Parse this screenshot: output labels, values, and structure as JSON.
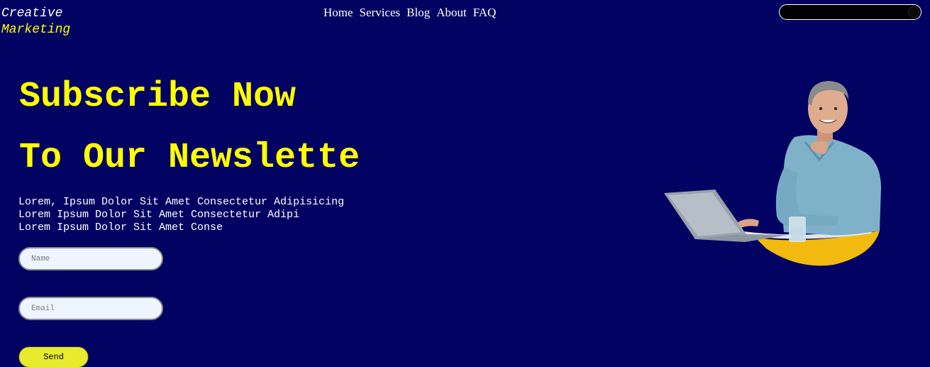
{
  "brand": {
    "line1": "Creative",
    "line2": "Marketing"
  },
  "nav": {
    "items": [
      "Home",
      "Services",
      "Blog",
      "About",
      "FAQ"
    ]
  },
  "search": {
    "placeholder": ""
  },
  "hero": {
    "title_line1": "Subscribe Now",
    "title_line2": "To Our Newslette",
    "description": [
      "Lorem, Ipsum Dolor Sit Amet Consectetur Adipisicing",
      "Lorem Ipsum Dolor Sit Amet Consectetur Adipi",
      "Lorem Ipsum Dolor Sit Amet Conse"
    ]
  },
  "form": {
    "name_placeholder": "Name",
    "email_placeholder": "Email",
    "send_label": "Send"
  },
  "colors": {
    "background": "#020263",
    "accent": "#ffff00",
    "button": "#e8ea2e"
  }
}
